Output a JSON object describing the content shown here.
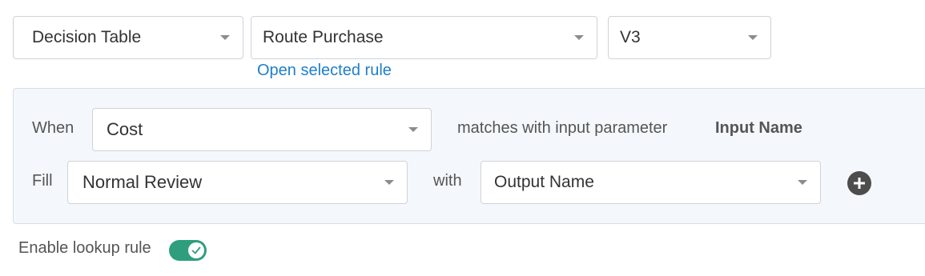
{
  "selectors": {
    "type": "Decision Table",
    "rule": "Route Purchase",
    "version": "V3"
  },
  "open_link": "Open selected rule",
  "when_row": {
    "label": "When",
    "value": "Cost",
    "matches_text": "matches with input parameter",
    "input_name": "Input Name"
  },
  "fill_row": {
    "label": "Fill",
    "value": "Normal Review",
    "with_text": "with",
    "output_value": "Output Name"
  },
  "lookup": {
    "label": "Enable lookup rule",
    "enabled": true
  },
  "colors": {
    "link": "#1e7fc9",
    "toggle_on": "#2e9e7e",
    "panel_bg": "#f4f8fc"
  },
  "icons": [
    "chevron-down-icon",
    "plus-circle-icon",
    "check-icon"
  ]
}
